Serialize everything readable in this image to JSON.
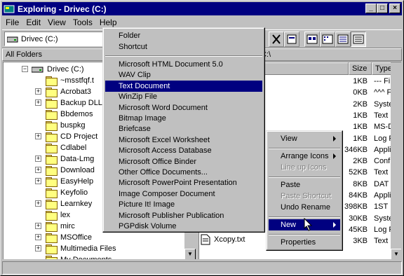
{
  "window": {
    "title": "Exploring - Drivec (C:)",
    "controls": [
      "_",
      "□",
      "×"
    ]
  },
  "menubar": [
    "File",
    "Edit",
    "View",
    "Tools",
    "Help"
  ],
  "address": {
    "value": "Drivec (C:)"
  },
  "pane": {
    "left_header": "All Folders",
    "right_header": "C:\\"
  },
  "tree": {
    "root": "Drivec (C:)",
    "items": [
      {
        "label": "~msstfqf.t",
        "expandable": false
      },
      {
        "label": "Acrobat3",
        "expandable": true
      },
      {
        "label": "Backup DLLs",
        "expandable": true
      },
      {
        "label": "Bbdemos",
        "expandable": false
      },
      {
        "label": "buspkg",
        "expandable": false
      },
      {
        "label": "CD Project",
        "expandable": true
      },
      {
        "label": "Cdlabel",
        "expandable": false
      },
      {
        "label": "Data-Lmg",
        "expandable": true
      },
      {
        "label": "Download",
        "expandable": true
      },
      {
        "label": "EasyHelp",
        "expandable": true
      },
      {
        "label": "Keyfolio",
        "expandable": false
      },
      {
        "label": "Learnkey",
        "expandable": true
      },
      {
        "label": "lex",
        "expandable": false
      },
      {
        "label": "mirc",
        "expandable": true
      },
      {
        "label": "MSOffice",
        "expandable": true
      },
      {
        "label": "Multimedia Files",
        "expandable": true
      },
      {
        "label": "My Documents",
        "expandable": false
      }
    ]
  },
  "list": {
    "columns": [
      "Size",
      "Type"
    ],
    "rows": [
      {
        "size": "1KB",
        "type": "--- File"
      },
      {
        "size": "0KB",
        "type": "^^^ F"
      },
      {
        "size": "2KB",
        "type": "Syste"
      },
      {
        "size": "1KB",
        "type": "Text"
      },
      {
        "size": "1KB",
        "type": "MS-D"
      },
      {
        "size": "1KB",
        "type": "Log F"
      },
      {
        "size": "346KB",
        "type": "Appli"
      },
      {
        "size": "2KB",
        "type": "Confi"
      },
      {
        "size": "52KB",
        "type": "Text"
      },
      {
        "size": "8KB",
        "type": "DAT"
      },
      {
        "size": "84KB",
        "type": "Appli"
      },
      {
        "size": "398KB",
        "type": "1ST"
      },
      {
        "size": "30KB",
        "type": "Syste"
      },
      {
        "size": "45KB",
        "type": "Log F"
      },
      {
        "size": "3KB",
        "type": "Text"
      }
    ],
    "visible_name": "Xcopy.txt"
  },
  "context_menu": {
    "items": [
      "View",
      "Arrange Icons",
      "Line up Icons",
      "Paste",
      "Paste Shortcut",
      "Undo Rename",
      "New",
      "Properties"
    ]
  },
  "new_submenu": {
    "top_items": [
      "Folder",
      "Shortcut"
    ],
    "items": [
      "Microsoft HTML Document 5.0",
      "WAV Clip",
      "Text Document",
      "WinZip File",
      "Microsoft Word Document",
      "Bitmap Image",
      "Briefcase",
      "Microsoft Excel Worksheet",
      "Microsoft Access Database",
      "Microsoft Office Binder",
      "Other Office Documents...",
      "Microsoft PowerPoint Presentation",
      "Image Composer Document",
      "Picture It! Image",
      "Microsoft Publisher Publication",
      "PGPdisk Volume"
    ],
    "selected": "Text Document"
  }
}
